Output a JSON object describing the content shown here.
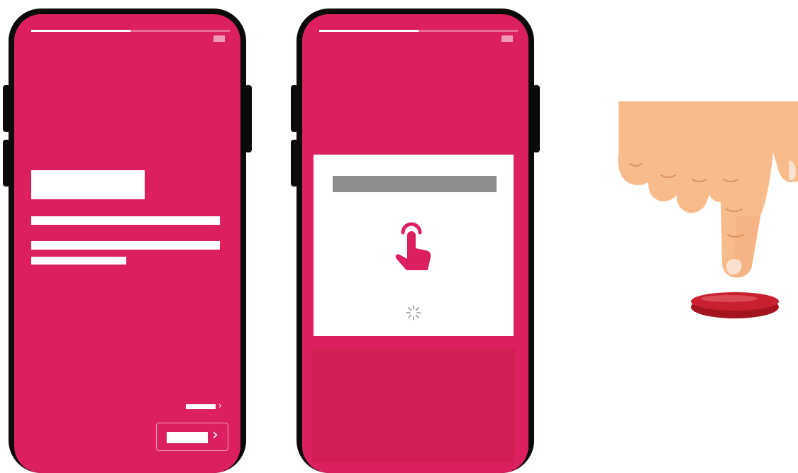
{
  "colors": {
    "brand": "#dc1f5f",
    "phone_frame": "#0a0a0a",
    "skin": "#f8bb8c",
    "button_red": "#c8202f",
    "placeholder_gray": "#8d8d8d"
  },
  "phones": [
    {
      "progress": 0.5,
      "has_content_blocks": true,
      "has_next_link": true,
      "has_next_button": true
    },
    {
      "progress": 0.5,
      "card_icon": "tap-finger-icon",
      "loading_icon": "spinner-icon"
    }
  ],
  "illustration": {
    "icon": "pointing-hand-icon",
    "target": "red-push-button-icon"
  }
}
